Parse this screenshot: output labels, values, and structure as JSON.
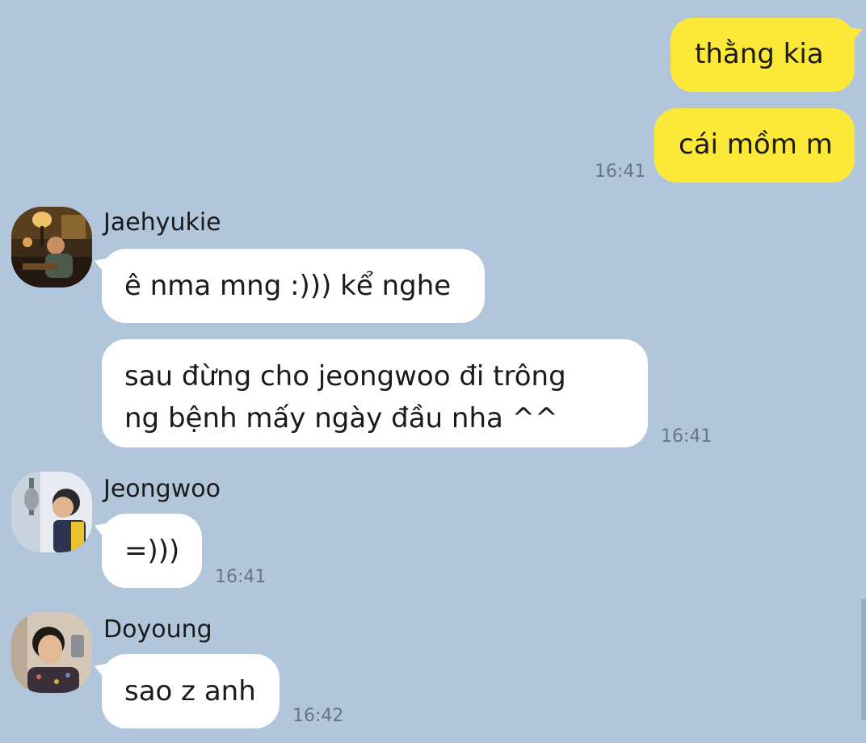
{
  "outgoing": [
    {
      "text": "thằng kia"
    },
    {
      "text": "cái mồm m",
      "time": "16:41"
    }
  ],
  "threads": [
    {
      "sender": "Jaehyukie",
      "avatar_icon": "lamp-room-photo-icon",
      "messages": [
        {
          "lines": [
            "ê nma mng :))) kể nghe"
          ]
        },
        {
          "lines": [
            "sau đừng cho jeongwoo đi trông",
            "ng bệnh mấy ngày đầu nha ^^"
          ],
          "time": "16:41"
        }
      ]
    },
    {
      "sender": "Jeongwoo",
      "avatar_icon": "studio-mic-photo-icon",
      "messages": [
        {
          "lines": [
            "=)))"
          ],
          "time": "16:41"
        }
      ]
    },
    {
      "sender": "Doyoung",
      "avatar_icon": "mirror-selfie-photo-icon",
      "messages": [
        {
          "lines": [
            "sao z anh"
          ],
          "time": "16:42"
        }
      ]
    }
  ],
  "colors": {
    "background": "#b1c6da",
    "outgoing_bubble": "#fce839",
    "incoming_bubble": "#ffffff",
    "timestamp": "#6a7583"
  }
}
